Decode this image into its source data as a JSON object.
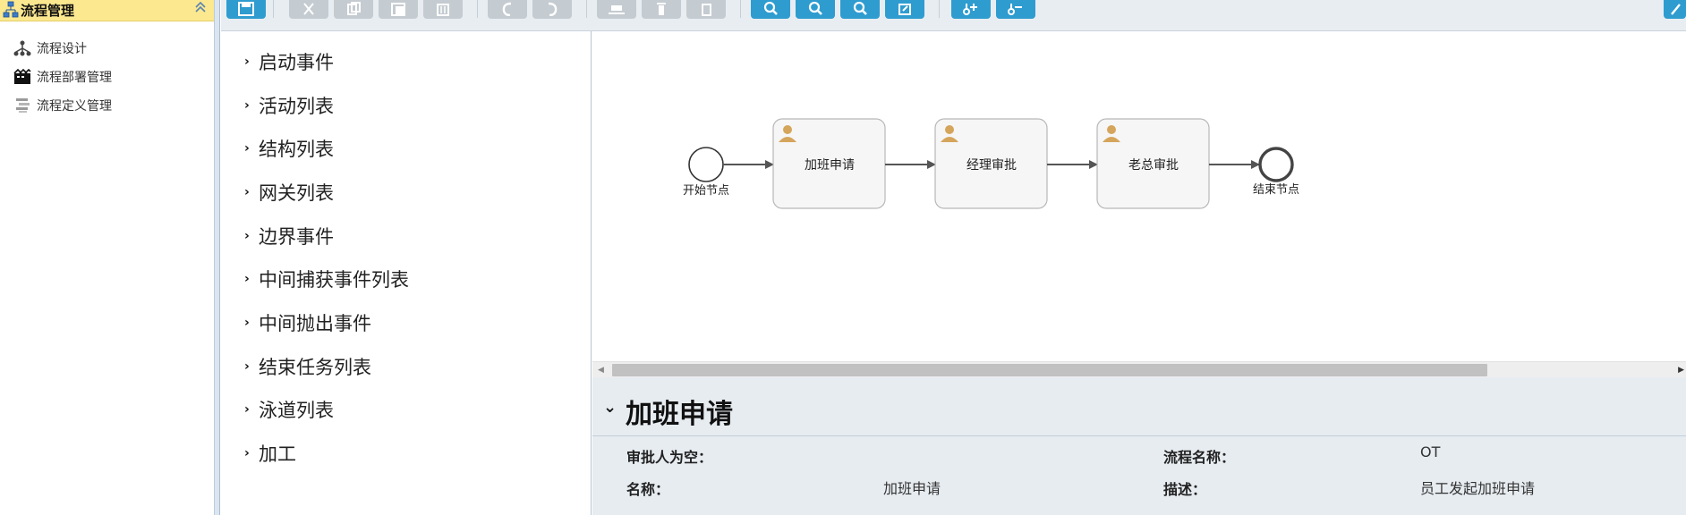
{
  "sidebar": {
    "header": {
      "title": "流程管理",
      "icon": "tree-icon"
    },
    "items": [
      {
        "label": "流程设计",
        "icon": "org-chart-icon"
      },
      {
        "label": "流程部署管理",
        "icon": "film-icon"
      },
      {
        "label": "流程定义管理",
        "icon": "list-icon"
      }
    ]
  },
  "toolbar": {
    "buttons": [
      {
        "name": "save",
        "icon": "save-icon",
        "color": "#2f9cd0"
      },
      {
        "name": "cut",
        "icon": "scissors-icon",
        "color": "#c4cbd1"
      },
      {
        "name": "copy",
        "icon": "copy-icon",
        "color": "#c4cbd1"
      },
      {
        "name": "paste",
        "icon": "paste-icon",
        "color": "#c4cbd1"
      },
      {
        "name": "delete",
        "icon": "trash-icon",
        "color": "#c4cbd1"
      },
      {
        "name": "undo",
        "icon": "undo-icon",
        "color": "#c4cbd1"
      },
      {
        "name": "redo",
        "icon": "redo-icon",
        "color": "#c4cbd1"
      },
      {
        "name": "align-vertical",
        "icon": "align-vertical-icon",
        "color": "#c4cbd1"
      },
      {
        "name": "align-horizontal",
        "icon": "align-horizontal-icon",
        "color": "#c4cbd1"
      },
      {
        "name": "same-size",
        "icon": "same-size-icon",
        "color": "#c4cbd1"
      },
      {
        "name": "zoom-in",
        "icon": "zoom-in-icon",
        "color": "#2f9cd0"
      },
      {
        "name": "zoom-out",
        "icon": "zoom-out-icon",
        "color": "#2f9cd0"
      },
      {
        "name": "zoom-actual",
        "icon": "zoom-actual-icon",
        "color": "#2f9cd0"
      },
      {
        "name": "zoom-fit",
        "icon": "zoom-fit-icon",
        "color": "#2f9cd0"
      },
      {
        "name": "add-bendpoint",
        "icon": "add-bendpoint-icon",
        "color": "#2f9cd0"
      },
      {
        "name": "remove-bendpoint",
        "icon": "remove-bendpoint-icon",
        "color": "#2f9cd0"
      },
      {
        "name": "expand",
        "icon": "expand-icon",
        "color": "#2f9cd0"
      }
    ]
  },
  "categories": [
    "启动事件",
    "活动列表",
    "结构列表",
    "网关列表",
    "边界事件",
    "中间捕获事件列表",
    "中间抛出事件",
    "结束任务列表",
    "泳道列表",
    "加工"
  ],
  "diagram": {
    "start_label": "开始节点",
    "end_label": "结束节点",
    "tasks": [
      "加班申请",
      "经理审批",
      "老总审批"
    ],
    "task_icon": "user-icon"
  },
  "properties": {
    "title": "加班申请",
    "rows": [
      {
        "label": "审批人为空：",
        "value": "",
        "label2": "流程名称：",
        "value2": "OT"
      },
      {
        "label": "名称：",
        "value": "加班申请",
        "label2": "描述：",
        "value2": "员工发起加班申请"
      }
    ]
  }
}
